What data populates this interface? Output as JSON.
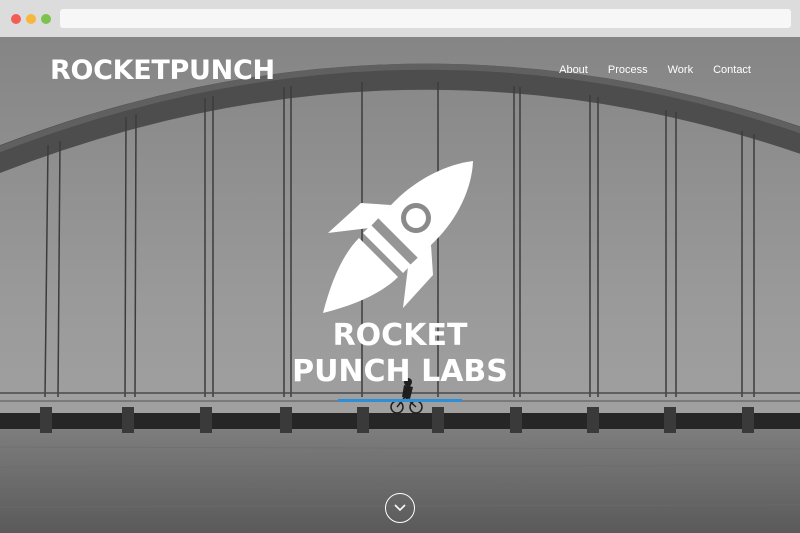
{
  "brand": {
    "name": "ROCKETPUNCH"
  },
  "nav": {
    "items": [
      {
        "label": "About"
      },
      {
        "label": "Process"
      },
      {
        "label": "Work"
      },
      {
        "label": "Contact"
      }
    ]
  },
  "hero": {
    "title_line1": "ROCKET",
    "title_line2": "PUNCH LABS"
  },
  "colors": {
    "accent": "#2f8fd6",
    "chrome": "#dcdcdc",
    "hero_tint": "#8e8e8e"
  },
  "icons": {
    "logo": "rocket-icon",
    "scroll": "chevron-down-icon"
  }
}
